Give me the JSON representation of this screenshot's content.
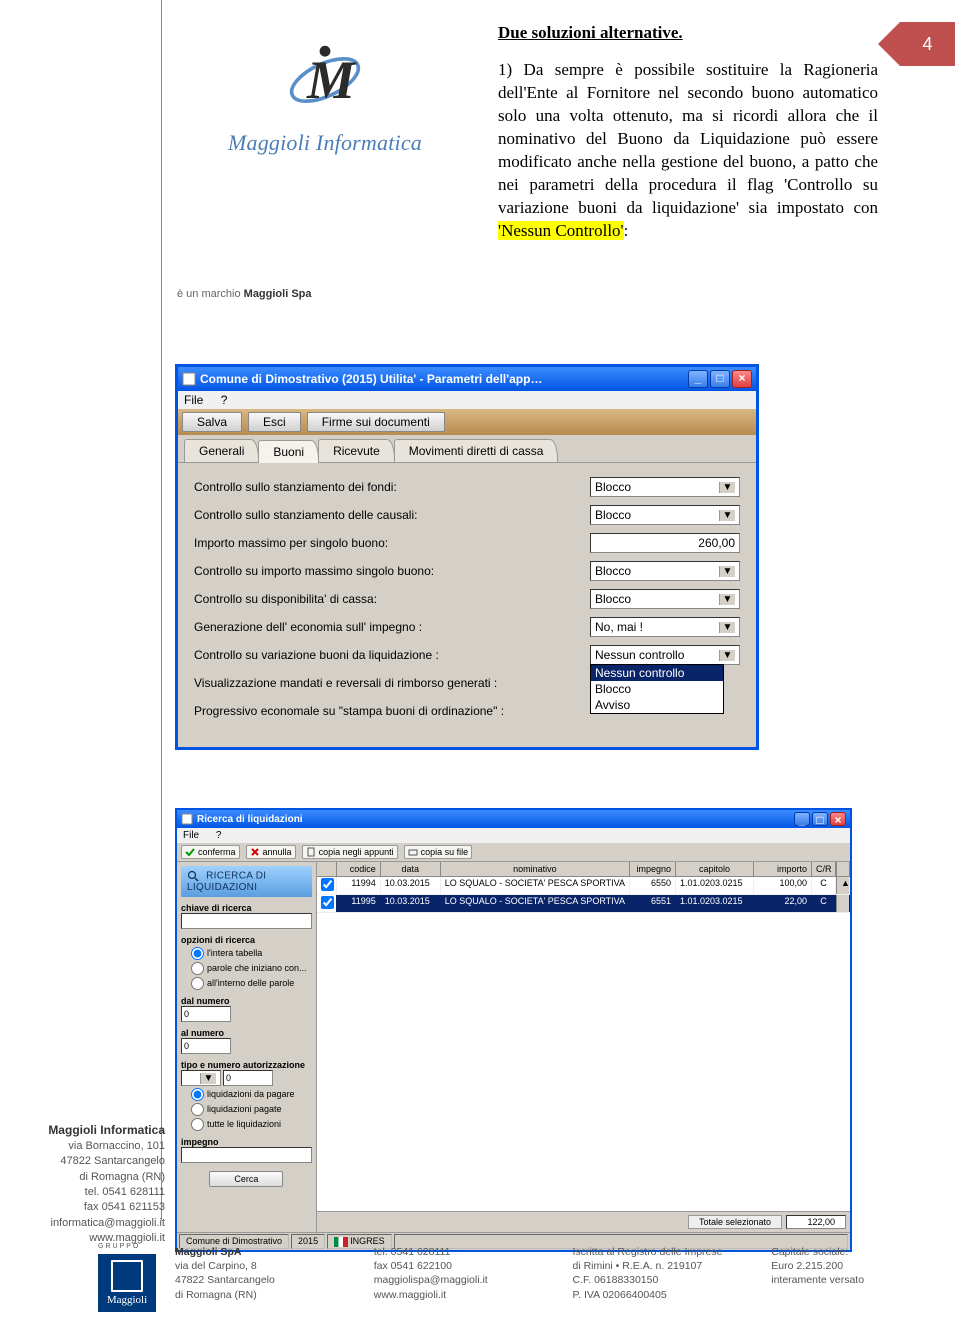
{
  "page_number": "4",
  "heading": "Due soluzioni alternative.",
  "body_before_hl": "1) Da sempre è possibile sostituire la Ragioneria dell'Ente al Fornitore nel secondo buono automatico solo una volta ottenuto, ma si ricordi allora che il nominativo del Buono da Liquidazione può essere modificato anche nella gestione del buono, a patto che nei parametri della procedura il flag 'Controllo su variazione buoni da liquidazione' sia impostato con ",
  "hl_text": "'Nessun Controllo'",
  "body_after_hl": ":",
  "logo_text": "Maggioli Informatica",
  "marchio_pre": "è un marchio ",
  "marchio_bold": "Maggioli Spa",
  "win1": {
    "title": "Comune di Dimostrativo (2015) Utilita' - Parametri dell'app…",
    "menu": [
      "File",
      "?"
    ],
    "toolbar": {
      "salva": "Salva",
      "esci": "Esci",
      "firme": "Firme sui documenti"
    },
    "tabs": {
      "t0": "Generali",
      "t1": "Buoni",
      "t2": "Ricevute",
      "t3": "Movimenti diretti di cassa"
    },
    "rows": {
      "r0": {
        "label": "Controllo sullo stanziamento dei fondi:",
        "value": "Blocco"
      },
      "r1": {
        "label": "Controllo sullo stanziamento delle causali:",
        "value": "Blocco"
      },
      "r2": {
        "label": "Importo massimo per singolo buono:",
        "value": "260,00"
      },
      "r3": {
        "label": "Controllo su importo massimo singolo buono:",
        "value": "Blocco"
      },
      "r4": {
        "label": "Controllo su disponibilita' di cassa:",
        "value": "Blocco"
      },
      "r5": {
        "label": "Generazione dell' economia sull' impegno :",
        "value": "No, mai !"
      },
      "r6": {
        "label": "Controllo su variazione buoni da liquidazione :",
        "value": "Nessun controllo"
      },
      "r7": {
        "label": "Visualizzazione mandati e reversali di rimborso generati :",
        "value": ""
      },
      "r8": {
        "label": "Progressivo economale su \"stampa buoni di ordinazione\" :",
        "value": ""
      }
    },
    "dropdown": {
      "o0": "Nessun controllo",
      "o1": "Blocco",
      "o2": "Avviso"
    }
  },
  "win2": {
    "title": "Ricerca di liquidazioni",
    "menu": [
      "File",
      "?"
    ],
    "tools": {
      "conferma": "conferma",
      "annulla": "annulla",
      "copia1": "copia negli appunti",
      "copia2": "copia su file"
    },
    "search": {
      "heading": "RICERCA DI LIQUIDAZIONI",
      "chiave": "chiave di ricerca",
      "opzioni": "opzioni di ricerca",
      "opt0": "l'intera tabella",
      "opt1": "parole che iniziano con...",
      "opt2": "all'interno delle parole",
      "dal": "dal numero",
      "al": "al numero",
      "dalv": "0",
      "alv": "0",
      "tipo": "tipo e numero autorizzazione",
      "tipov": "0",
      "f0": "liquidazioni da pagare",
      "f1": "liquidazioni pagate",
      "f2": "tutte le liquidazioni",
      "impegno": "impegno",
      "cerca": "Cerca"
    },
    "headers": {
      "codice": "codice",
      "data": "data",
      "nominativo": "nominativo",
      "impegno": "impegno",
      "capitolo": "capitolo",
      "importo": "importo",
      "cr": "C/R"
    },
    "rows": [
      {
        "codice": "11994",
        "data": "10.03.2015",
        "nominativo": "LO SQUALO - SOCIETA' PESCA SPORTIVA",
        "impegno": "6550",
        "capitolo": "1.01.0203.0215",
        "importo": "100,00",
        "cr": "C"
      },
      {
        "codice": "11995",
        "data": "10.03.2015",
        "nominativo": "LO SQUALO - SOCIETA' PESCA SPORTIVA",
        "impegno": "6551",
        "capitolo": "1.01.0203.0215",
        "importo": "22,00",
        "cr": "C"
      }
    ],
    "total_label": "Totale selezionato",
    "total_value": "122,00",
    "status0": "Comune di Dimostrativo",
    "status1": "2015",
    "status2": "INGRES"
  },
  "addr": {
    "head": "Maggioli Informatica",
    "l1": "via Bornaccino, 101",
    "l2": "47822 Santarcangelo",
    "l3": "di Romagna (RN)",
    "l4": "tel. 0541 628111",
    "l5": "fax 0541 621153",
    "l6": "informatica@maggioli.it",
    "l7": "www.maggioli.it"
  },
  "footer": {
    "gruppo": "gruppo",
    "logo": "Maggioli",
    "c1": {
      "h": "Maggioli SpA",
      "l1": "via del Carpino, 8",
      "l2": "47822 Santarcangelo",
      "l3": "di Romagna (RN)"
    },
    "c2": {
      "l1": "tel. 0541 628111",
      "l2": "fax 0541 622100",
      "l3": "maggiolispa@maggioli.it",
      "l4": "www.maggioli.it"
    },
    "c3": {
      "l1": "Iscritta al Registro delle Imprese",
      "l2": "di Rimini • R.E.A. n. 219107",
      "l3": "C.F. 06188330150",
      "l4": "P. IVA 02066400405"
    },
    "c4": {
      "l1": "Capitale sociale:",
      "l2": "Euro 2.215.200",
      "l3": "interamente versato"
    }
  }
}
